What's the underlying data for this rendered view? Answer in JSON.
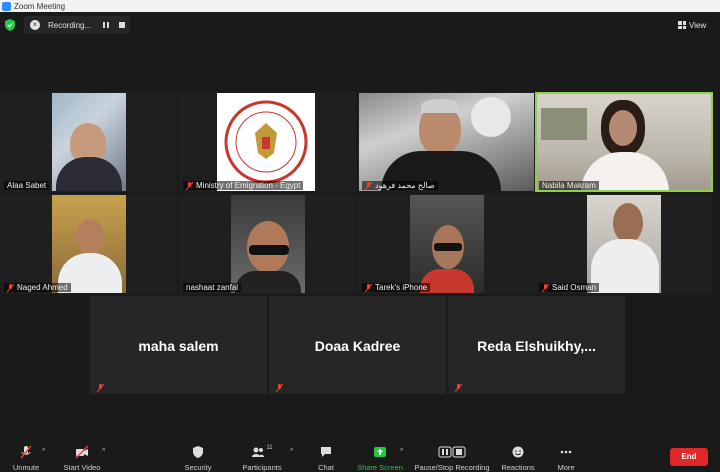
{
  "window": {
    "title": "Zoom Meeting"
  },
  "recording": {
    "label": "Recording..."
  },
  "view": {
    "label": "View"
  },
  "participants": [
    {
      "name": "Alaa Sabet",
      "muted": false,
      "active": false
    },
    {
      "name": "Ministry of Emigration - Egypt",
      "muted": true,
      "active": false
    },
    {
      "name": "صالح محمد فرهود",
      "muted": true,
      "active": false
    },
    {
      "name": "Nabila Makram",
      "muted": false,
      "active": true
    },
    {
      "name": "Naged Ahmed",
      "muted": true,
      "active": false
    },
    {
      "name": "nashaat zanfal",
      "muted": false,
      "active": false
    },
    {
      "name": "Tarek's iPhone",
      "muted": true,
      "active": false
    },
    {
      "name": "Said Osman",
      "muted": true,
      "active": false
    }
  ],
  "no_video_participants": [
    {
      "name": "maha  salem",
      "muted": true
    },
    {
      "name": "Doaa Kadree",
      "muted": true
    },
    {
      "name": "Reda  Elshuikhy,...",
      "muted": true
    }
  ],
  "toolbar": {
    "unmute": "Unmute",
    "start_video": "Start Video",
    "security": "Security",
    "participants": "Participants",
    "participants_count": "11",
    "chat": "Chat",
    "share_screen": "Share Screen",
    "pause_recording": "Pause/Stop Recording",
    "reactions": "Reactions",
    "more": "More",
    "end": "End"
  },
  "colors": {
    "active_border": "#8fd14f",
    "end_button": "#e02828",
    "share_green": "#27c840",
    "shield_green": "#27c840"
  }
}
